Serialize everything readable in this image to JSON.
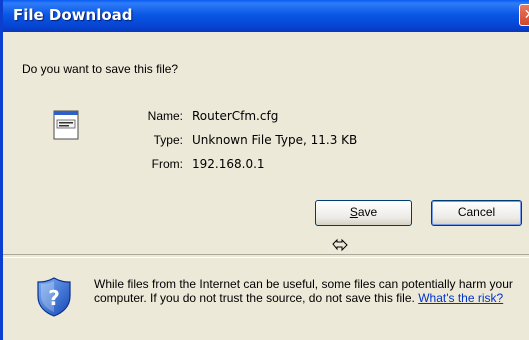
{
  "window": {
    "title": "File Download",
    "close_glyph": "✕"
  },
  "prompt": {
    "question": "Do you want to save this file?"
  },
  "file": {
    "icon": "file-icon",
    "name_label": "Name:",
    "name_value": "RouterCfm.cfg",
    "type_label": "Type:",
    "type_value": "Unknown File Type, 11.3 KB",
    "from_label": "From:",
    "from_value": "192.168.0.1"
  },
  "buttons": {
    "save_label_underlined": "S",
    "save_label_rest": "ave",
    "cancel_label": "Cancel"
  },
  "warning": {
    "icon": "shield-question-icon",
    "text": "While files from the Internet can be useful, some files can potentially harm your computer. If you do not trust the source, do not save this file. ",
    "link_text": "What's the risk?"
  },
  "colors": {
    "titlebar": "#0b58e6",
    "dialog_bg": "#ece9d8",
    "link": "#0033cc"
  }
}
